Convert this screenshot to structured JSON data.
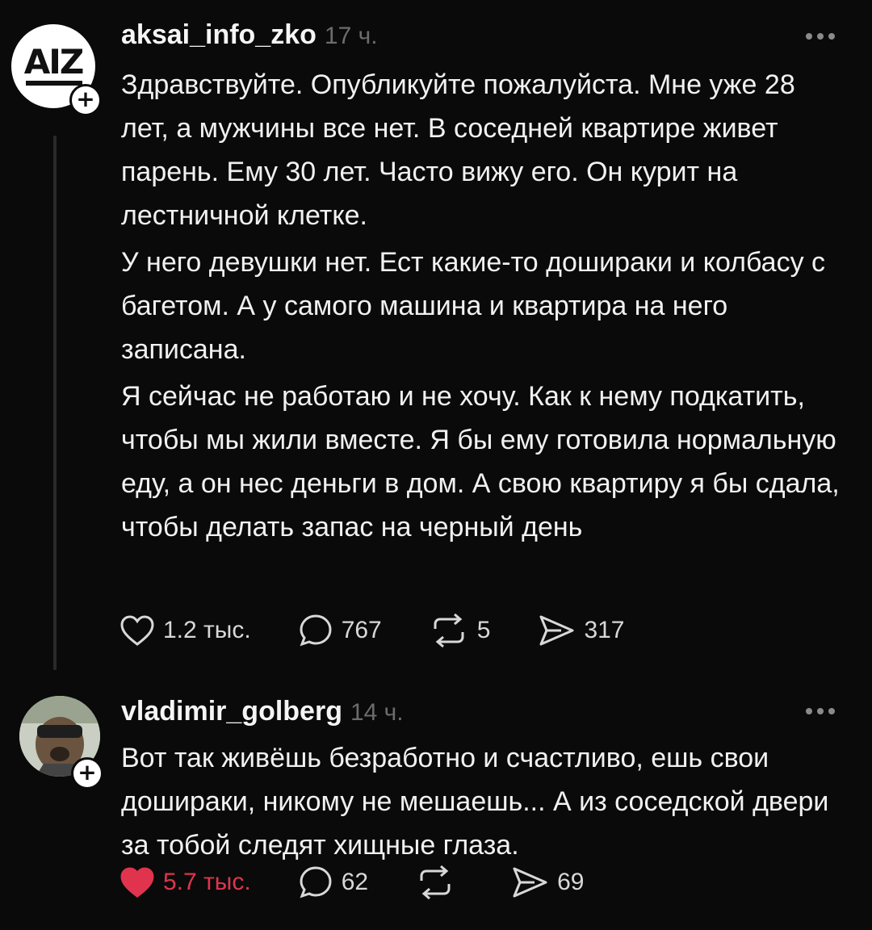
{
  "posts": [
    {
      "username": "aksai_info_zko",
      "time": "17 ч.",
      "avatar_text": "AIZ",
      "paragraphs": [
        "Здравствуйте. Опубликуйте пожалуйста. Мне уже 28 лет, а мужчины все нет. В соседней квартире живет парень. Ему 30 лет. Часто вижу его. Он курит на лестничной клетке.",
        "У него девушки нет. Ест какие-то дошираки и колбасу с багетом. А у самого машина и квартира на него записана.",
        "Я сейчас не работаю и не хочу. Как к нему подкатить, чтобы мы жили вместе. Я бы ему готовила нормальную еду, а он нес деньги в дом. А свою квартиру я бы сдала, чтобы делать запас на черный день"
      ],
      "likes": "1.2 тыс.",
      "comments": "767",
      "reposts": "5",
      "shares": "317",
      "liked": false
    },
    {
      "username": "vladimir_golberg",
      "time": "14 ч.",
      "paragraphs": [
        "Вот так живёшь безработно и счастливо, ешь свои дошираки, никому не мешаешь... А из соседской двери за тобой следят хищные глаза."
      ],
      "likes": "5.7 тыс.",
      "comments": "62",
      "reposts": "",
      "shares": "69",
      "liked": true
    }
  ],
  "colors": {
    "background": "#0a0a0a",
    "text": "#f1f1f1",
    "muted": "#6c6c6c",
    "like_active": "#e0344e"
  },
  "icons": {
    "like": "heart-icon",
    "comment": "comment-bubble-icon",
    "repost": "repost-arrows-icon",
    "share": "send-icon",
    "more": "more-dots-icon",
    "follow": "plus-icon"
  }
}
